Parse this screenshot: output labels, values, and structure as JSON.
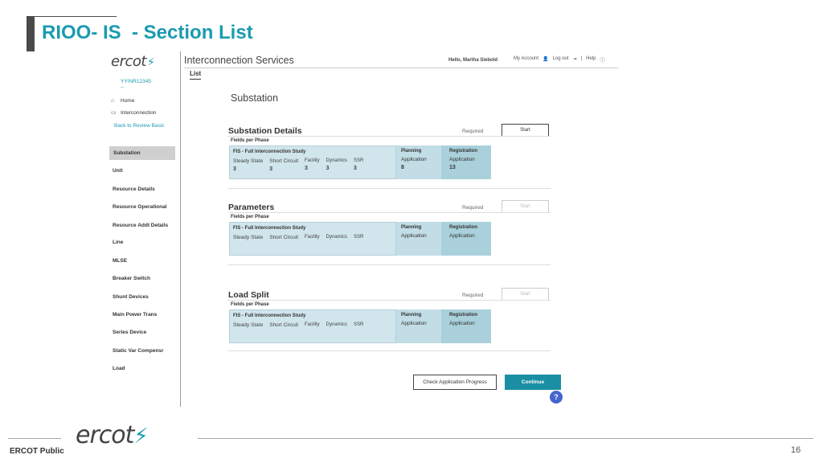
{
  "slide": {
    "title": "RIOO- IS  - Section List",
    "footer_label": "ERCOT Public",
    "page_number": "16",
    "logo_text": "ercot",
    "brand_color": "#1a9bb0"
  },
  "app": {
    "logo_text": "ercot",
    "title": "Interconnection Services",
    "greeting": "Hello, Martha Siebold",
    "my_account": "My Account",
    "logout": "Log out",
    "help": "Help",
    "tab": "List",
    "content_title": "Substation"
  },
  "sidebar": {
    "app_id": "YYINR12345",
    "app_id_sub": "--",
    "home": "Home",
    "interconnection": "Interconnection",
    "back": "Back to Review Basic",
    "sections": [
      "Substation",
      "Unit",
      "Resource Details",
      "Resource Operational",
      "Resource Addt Details",
      "Line",
      "MLSE",
      "Breaker Switch",
      "Shunt Devices",
      "Main Power Trans",
      "Series Device",
      "Static Var Compensr",
      "Load"
    ],
    "active_index": 0
  },
  "sections": [
    {
      "name": "Substation Details",
      "required": "Required",
      "button": "Start",
      "fields_label": "Fields per Phase",
      "fis_title": "FIS - Full Interconnection Study",
      "fis_cols": [
        {
          "label": "Steady State",
          "value": "3"
        },
        {
          "label": "Short Circuit",
          "value": "3"
        },
        {
          "label": "Facility",
          "value": "3"
        },
        {
          "label": "Dynamics",
          "value": "3"
        },
        {
          "label": "SSR",
          "value": "3"
        }
      ],
      "planning": {
        "head": "Planning",
        "label": "Application",
        "value": "8"
      },
      "registration": {
        "head": "Registration",
        "label": "Application",
        "value": "13"
      }
    },
    {
      "name": "Parameters",
      "required": "Required",
      "button": "Start",
      "fields_label": "Fields per Phase",
      "fis_title": "FIS - Full Interconnection Study",
      "fis_cols": [
        {
          "label": "Steady State",
          "value": ""
        },
        {
          "label": "Short Circuit",
          "value": ""
        },
        {
          "label": "Facility",
          "value": ""
        },
        {
          "label": "Dynamics",
          "value": ""
        },
        {
          "label": "SSR",
          "value": ""
        }
      ],
      "planning": {
        "head": "Planning",
        "label": "Application",
        "value": ""
      },
      "registration": {
        "head": "Registration",
        "label": "Application",
        "value": ""
      }
    },
    {
      "name": "Load Split",
      "required": "Required",
      "button": "Start",
      "fields_label": "Fields per Phase",
      "fis_title": "FIS - Full Interconnection Study",
      "fis_cols": [
        {
          "label": "Steady State",
          "value": ""
        },
        {
          "label": "Short Circuit",
          "value": ""
        },
        {
          "label": "Facility",
          "value": ""
        },
        {
          "label": "Dynamics",
          "value": ""
        },
        {
          "label": "SSR",
          "value": ""
        }
      ],
      "planning": {
        "head": "Planning",
        "label": "Application",
        "value": ""
      },
      "registration": {
        "head": "Registration",
        "label": "Application",
        "value": ""
      }
    }
  ],
  "actions": {
    "check_progress": "Check Application Progress",
    "continue": "Continue",
    "help_fab": "?"
  }
}
